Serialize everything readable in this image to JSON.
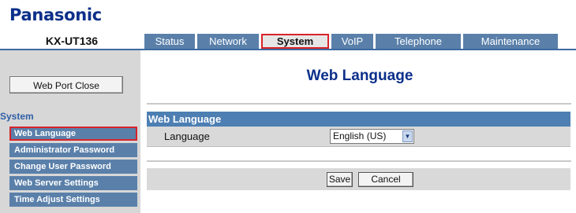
{
  "brand": "Panasonic",
  "model": "KX-UT136",
  "tabs": [
    {
      "label": "Status",
      "active": false
    },
    {
      "label": "Network",
      "active": false
    },
    {
      "label": "System",
      "active": true
    },
    {
      "label": "VoIP",
      "active": false
    },
    {
      "label": "Telephone",
      "active": false
    },
    {
      "label": "Maintenance",
      "active": false
    }
  ],
  "sidebar": {
    "port_close_button": "Web Port Close",
    "section_title": "System",
    "items": [
      {
        "label": "Web Language",
        "active": true
      },
      {
        "label": "Administrator Password",
        "active": false
      },
      {
        "label": "Change User Password",
        "active": false
      },
      {
        "label": "Web Server Settings",
        "active": false
      },
      {
        "label": "Time Adjust Settings",
        "active": false
      }
    ]
  },
  "main": {
    "page_title": "Web Language",
    "section_title": "Web Language",
    "language_label": "Language",
    "language_value": "English (US)",
    "save_button": "Save",
    "cancel_button": "Cancel"
  },
  "colors": {
    "brand_blue": "#0b2f8a",
    "tab_blue": "#5a80aa",
    "section_blue": "#4d7fb3",
    "highlight_red": "#d8232a"
  }
}
